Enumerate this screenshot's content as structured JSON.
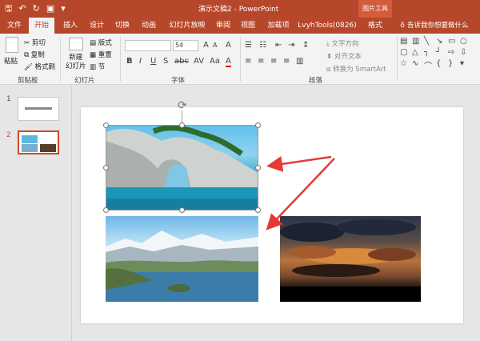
{
  "titlebar": {
    "title": "演示文稿2  -  PowerPoint",
    "context_tab_group": "图片工具",
    "qat_icons": [
      "save-icon",
      "undo-icon",
      "redo-icon",
      "slideshow-icon",
      "customize-icon"
    ]
  },
  "tabs": {
    "items": [
      "文件",
      "开始",
      "插入",
      "设计",
      "切换",
      "动画",
      "幻灯片放映",
      "审阅",
      "视图",
      "加载项",
      "LvyhTools(0826)",
      "格式"
    ],
    "active": "开始",
    "tell_me": "告诉我你想要做什么"
  },
  "ribbon": {
    "clipboard": {
      "paste": "粘贴",
      "cut": "剪切",
      "copy": "复制",
      "format_painter": "格式刷",
      "label": "剪贴板"
    },
    "slides": {
      "new_slide": "新建\n幻灯片",
      "layout": "版式",
      "reset": "重置",
      "section": "节",
      "label": "幻灯片"
    },
    "font": {
      "font_size": "54",
      "label": "字体"
    },
    "paragraph": {
      "text_direction": "文字方向",
      "align_text": "对齐文本",
      "smartart": "转换为 SmartArt",
      "label": "段落"
    }
  },
  "thumbnails": [
    {
      "number": "1",
      "selected": false
    },
    {
      "number": "2",
      "selected": true
    }
  ],
  "colors": {
    "accent": "#b7472a",
    "selection": "#d24726",
    "arrow": "#e53935"
  }
}
